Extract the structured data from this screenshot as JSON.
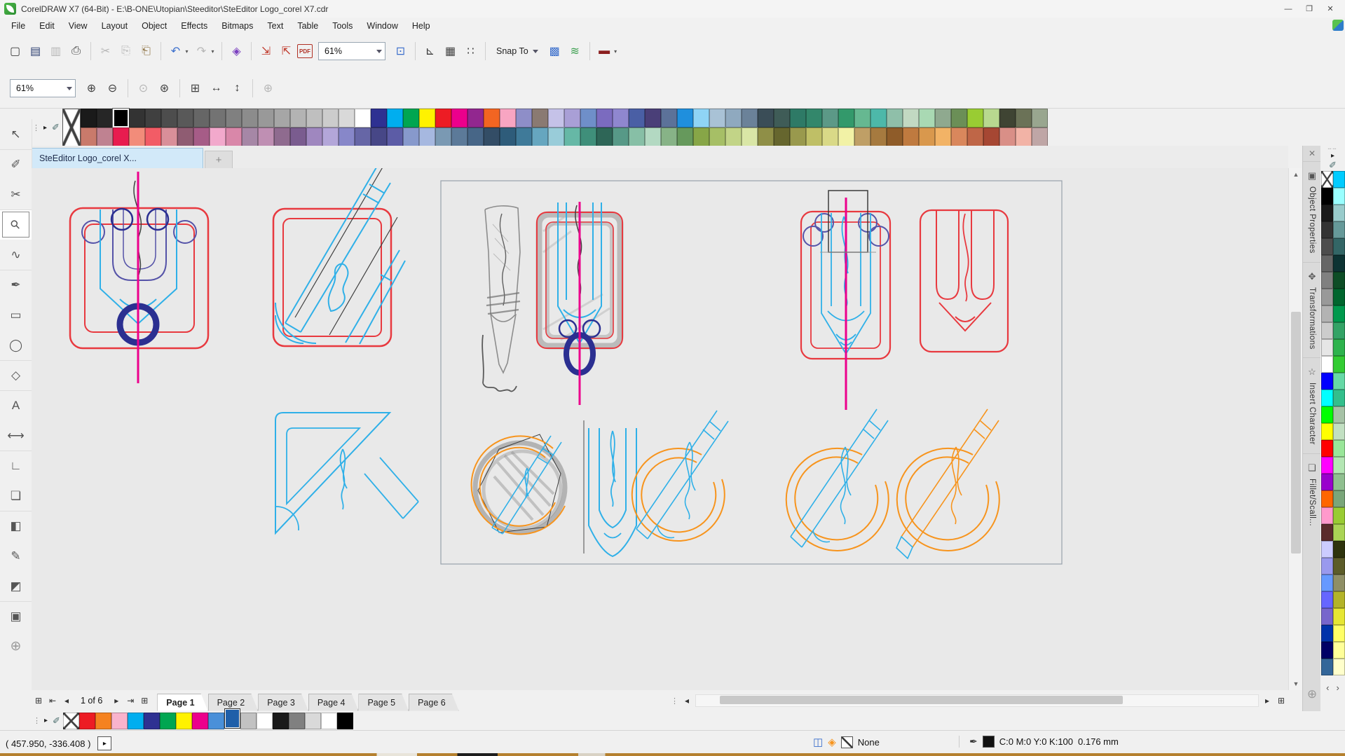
{
  "window": {
    "title": "CorelDRAW X7 (64-Bit) - E:\\B-ONE\\Utopian\\Steeditor\\SteEditor Logo_corel X7.cdr",
    "minimize_icon": "—",
    "restore_icon": "❐",
    "close_icon": "✕"
  },
  "menu": {
    "items": [
      "File",
      "Edit",
      "View",
      "Layout",
      "Object",
      "Effects",
      "Bitmaps",
      "Text",
      "Table",
      "Tools",
      "Window",
      "Help"
    ]
  },
  "toolbar": {
    "zoom_value": "61%",
    "snap_to_label": "Snap To",
    "left_icons": [
      {
        "name": "new-document-icon",
        "glyph": "▢",
        "cls": "ink",
        "ia": "true"
      },
      {
        "name": "open-icon",
        "glyph": "▤",
        "cls": "navy",
        "ia": "true"
      },
      {
        "name": "save-icon",
        "glyph": "▥",
        "cls": "dis",
        "ia": "true"
      },
      {
        "name": "print-icon",
        "glyph": "⎙",
        "cls": "ink",
        "ia": "true"
      },
      {
        "name": "separator",
        "glyph": "",
        "cls": "sep",
        "ia": "false"
      },
      {
        "name": "cut-icon",
        "glyph": "✂",
        "cls": "dis",
        "ia": "true"
      },
      {
        "name": "copy-icon",
        "glyph": "⎘",
        "cls": "dis",
        "ia": "true"
      },
      {
        "name": "paste-icon",
        "glyph": "⎗",
        "cls": "tan",
        "ia": "true"
      },
      {
        "name": "separator",
        "glyph": "",
        "cls": "sep",
        "ia": "false"
      },
      {
        "name": "undo-icon",
        "glyph": "↶",
        "cls": "blue",
        "ia": "true"
      },
      {
        "name": "undo-dropdown-icon",
        "glyph": "▾",
        "cls": "tiny",
        "ia": "true"
      },
      {
        "name": "redo-icon",
        "glyph": "↷",
        "cls": "dis",
        "ia": "true"
      },
      {
        "name": "redo-dropdown-icon",
        "glyph": "▾",
        "cls": "tiny dis",
        "ia": "true"
      },
      {
        "name": "separator",
        "glyph": "",
        "cls": "sep",
        "ia": "false"
      },
      {
        "name": "search-content-icon",
        "glyph": "◈",
        "cls": "purple",
        "ia": "true"
      },
      {
        "name": "separator",
        "glyph": "",
        "cls": "sep",
        "ia": "false"
      },
      {
        "name": "import-icon",
        "glyph": "⇲",
        "cls": "red",
        "ia": "true"
      },
      {
        "name": "export-icon",
        "glyph": "⇱",
        "cls": "red",
        "ia": "true"
      },
      {
        "name": "publish-pdf-icon",
        "glyph": "PDF",
        "cls": "pdf",
        "ia": "true"
      }
    ],
    "mid_icons": [
      {
        "name": "fullscreen-preview-icon",
        "glyph": "⊡",
        "cls": "blue",
        "ia": "true"
      },
      {
        "name": "separator",
        "glyph": "",
        "cls": "sep",
        "ia": "false"
      },
      {
        "name": "show-rulers-icon",
        "glyph": "⊾",
        "cls": "ink",
        "ia": "true"
      },
      {
        "name": "show-grid-icon",
        "glyph": "▦",
        "cls": "ink",
        "ia": "true"
      },
      {
        "name": "show-guidelines-icon",
        "glyph": "∷",
        "cls": "ink",
        "ia": "true"
      },
      {
        "name": "separator",
        "glyph": "",
        "cls": "sep",
        "ia": "false"
      }
    ],
    "right_icons": [
      {
        "name": "options-icon",
        "glyph": "▩",
        "cls": "blue",
        "ia": "true"
      },
      {
        "name": "quick-customize-icon",
        "glyph": "≋",
        "cls": "green",
        "ia": "true"
      },
      {
        "name": "separator",
        "glyph": "",
        "cls": "sep",
        "ia": "false"
      },
      {
        "name": "application-launcher-icon",
        "glyph": "▬",
        "cls": "darkred",
        "ia": "true"
      },
      {
        "name": "launcher-dropdown-icon",
        "glyph": "▾",
        "cls": "tiny",
        "ia": "true"
      }
    ]
  },
  "property_bar": {
    "zoom_value": "61%",
    "icons": [
      {
        "name": "zoom-in-icon",
        "glyph": "⊕",
        "cls": "ink",
        "ia": "true"
      },
      {
        "name": "zoom-out-icon",
        "glyph": "⊖",
        "cls": "ink",
        "ia": "true"
      },
      {
        "name": "separator",
        "glyph": "",
        "cls": "sep",
        "ia": "false"
      },
      {
        "name": "zoom-to-selected-icon",
        "glyph": "⊙",
        "cls": "dis",
        "ia": "true"
      },
      {
        "name": "zoom-to-all-objects-icon",
        "glyph": "⊛",
        "cls": "ink",
        "ia": "true"
      },
      {
        "name": "separator",
        "glyph": "",
        "cls": "sep",
        "ia": "false"
      },
      {
        "name": "zoom-to-page-icon",
        "glyph": "⊞",
        "cls": "ink",
        "ia": "true"
      },
      {
        "name": "zoom-to-page-width-icon",
        "glyph": "↔",
        "cls": "ink",
        "ia": "true"
      },
      {
        "name": "zoom-to-page-height-icon",
        "glyph": "↕",
        "cls": "ink",
        "ia": "true"
      },
      {
        "name": "separator",
        "glyph": "",
        "cls": "sep",
        "ia": "false"
      },
      {
        "name": "zoom-one-shot-icon",
        "glyph": "⊕",
        "cls": "dis",
        "ia": "true"
      }
    ]
  },
  "palette_top": {
    "grip_icon": "⋮",
    "flyout_icon": "▸",
    "eyedropper_icon": "✐",
    "selected_row": 1,
    "selected_index": 2,
    "row1": [
      "#1a1a1a",
      "#262626",
      "#000000",
      "#333333",
      "#404040",
      "#4d4d4d",
      "#595959",
      "#666666",
      "#737373",
      "#808080",
      "#8c8c8c",
      "#999999",
      "#a6a6a6",
      "#b3b3b3",
      "#bfbfbf",
      "#cccccc",
      "#d9d9d9",
      "#ffffff",
      "#2e3192",
      "#00aeef",
      "#00a651",
      "#fff200",
      "#ed1c24",
      "#ec008c",
      "#92278f",
      "#f26522",
      "#f8a5c2",
      "#8e8ec8",
      "#8a7a72",
      "#c5c2e8",
      "#a99fd6",
      "#6f8fc9",
      "#7b6bbf",
      "#8f87cf",
      "#4a5fa5",
      "#4a3f78",
      "#5c7299",
      "#1f8fdd",
      "#8fd4f5",
      "#a9c2d6",
      "#8fa9bf",
      "#6b8299",
      "#3a4d57",
      "#3f5c57",
      "#2e7a66",
      "#33876b",
      "#5c9987",
      "#33996b",
      "#66b891",
      "#4db8a9",
      "#8fbfa9",
      "#c2d9c2",
      "#a9d9b3",
      "#8fa98f",
      "#6b8f57",
      "#99cc33",
      "#b8d98f",
      "#3f4433",
      "#6b7257",
      "#99a68f"
    ],
    "row2": [
      "#c97a6b",
      "#bf8291",
      "#e81c4f",
      "#f28c7a",
      "#f25c66",
      "#d98f99",
      "#8f5c72",
      "#a65c87",
      "#f2a9cc",
      "#d987a9",
      "#a687a6",
      "#bf8fb3",
      "#8f6b8f",
      "#7a5c8f",
      "#9f87bf",
      "#b3a6d9",
      "#8787c9",
      "#6666a6",
      "#474787",
      "#5c5ca6",
      "#8799cc",
      "#a6b8e0",
      "#7a99b3",
      "#5c7a99",
      "#476687",
      "#334d66",
      "#2e5c7a",
      "#3f7a99",
      "#66a6bf",
      "#99ccd9",
      "#66b8a6",
      "#3f8f7a",
      "#2e6657",
      "#579987",
      "#87bfa6",
      "#b3d9c2",
      "#87b387",
      "#66995c",
      "#87a647",
      "#a6bf66",
      "#c2d487",
      "#d9e6a6",
      "#8f8f47",
      "#66662e",
      "#99994d",
      "#bfbf66",
      "#d9d987",
      "#f2f2a6",
      "#bf9f66",
      "#a67a3f",
      "#8f5c29",
      "#bf7a3f",
      "#d9984d",
      "#f2b366",
      "#d9875c",
      "#bf6647",
      "#a64733",
      "#d98f87",
      "#f2b3a6",
      "#bfa6a6"
    ]
  },
  "document_tabs": {
    "active_label": "SteEditor Logo_corel X...",
    "new_tab_icon": "+"
  },
  "toolbox": {
    "tools": [
      {
        "name": "pick-tool",
        "glyph": "↖",
        "active": "false",
        "ia": "true"
      },
      {
        "name": "shape-tool",
        "glyph": "✐",
        "active": "false",
        "ia": "true"
      },
      {
        "name": "crop-tool",
        "glyph": "✂",
        "active": "false",
        "ia": "true"
      },
      {
        "name": "zoom-tool",
        "glyph": "⚲",
        "active": "true",
        "ia": "true"
      },
      {
        "name": "freehand-tool",
        "glyph": "∿",
        "active": "false",
        "ia": "true"
      },
      {
        "name": "artistic-media-tool",
        "glyph": "✒",
        "active": "false",
        "ia": "true"
      },
      {
        "name": "rectangle-tool",
        "glyph": "▭",
        "active": "false",
        "ia": "true"
      },
      {
        "name": "ellipse-tool",
        "glyph": "◯",
        "active": "false",
        "ia": "true"
      },
      {
        "name": "polygon-tool",
        "glyph": "◇",
        "active": "false",
        "ia": "true"
      },
      {
        "name": "text-tool",
        "glyph": "A",
        "active": "false",
        "ia": "true"
      },
      {
        "name": "dimension-tool",
        "glyph": "⟷",
        "active": "false",
        "ia": "true"
      },
      {
        "name": "connector-tool",
        "glyph": "∟",
        "active": "false",
        "ia": "true"
      },
      {
        "name": "drop-shadow-tool",
        "glyph": "❏",
        "active": "false",
        "ia": "true"
      },
      {
        "name": "transparency-tool",
        "glyph": "◧",
        "active": "false",
        "ia": "true"
      },
      {
        "name": "color-eyedropper-tool",
        "glyph": "✎",
        "active": "false",
        "ia": "true"
      },
      {
        "name": "interactive-fill-tool",
        "glyph": "◩",
        "active": "false",
        "ia": "true"
      },
      {
        "name": "smart-fill-tool",
        "glyph": "▣",
        "active": "false",
        "ia": "true"
      },
      {
        "name": "add-tools-button",
        "glyph": "⊕",
        "active": "false",
        "ia": "true"
      }
    ]
  },
  "canvas": {
    "colors": {
      "outline_red": "#e8393f",
      "outline_cyan": "#2fb0e8",
      "outline_navy": "#2b2f91",
      "outline_purple": "#5553a8",
      "guide_magenta": "#ec008c",
      "outline_orange": "#f7941d",
      "sketch_gray": "#8d8d8d",
      "page_fill": "#ffffff",
      "desktop_fill": "#e9e9e9"
    }
  },
  "v_scrollbar": {
    "up_icon": "▲",
    "down_icon": "▼"
  },
  "h_scrollbar": {
    "grip_icon": "⋮",
    "left_icon": "◂",
    "right_icon": "▸",
    "page_zoom_icon": "⊞"
  },
  "dockers": {
    "close_icon": "✕",
    "add_icon": "⊕",
    "tabs": [
      {
        "name": "docker-tab-object-properties",
        "label": "Object Properties",
        "icon": "▣",
        "ia": "true"
      },
      {
        "name": "docker-tab-transformations",
        "label": "Transformations",
        "icon": "✥",
        "ia": "true"
      },
      {
        "name": "docker-tab-insert-character",
        "label": "Insert Character",
        "icon": "☆",
        "ia": "true"
      },
      {
        "name": "docker-tab-fillet-scallop",
        "label": "Fillet/Scall...",
        "icon": "❏",
        "ia": "true"
      }
    ]
  },
  "palette_right": {
    "grip_icon": "┄┄",
    "flyout_icon": "▸",
    "eyedropper_icon": "✐",
    "scroll_left_icon": "‹",
    "scroll_right_icon": "›",
    "col1": [
      "none",
      "#000000",
      "#1a1a1a",
      "#333333",
      "#4d4d4d",
      "#666666",
      "#808080",
      "#999999",
      "#b3b3b3",
      "#cccccc",
      "#e6e6e6",
      "#ffffff",
      "#0000ff",
      "#00ffff",
      "#00ff00",
      "#ffff00",
      "#ff0000",
      "#ff00ff",
      "#9900cc",
      "#ff6600",
      "#ff99cc",
      "#5b2b2b",
      "#ccccff",
      "#9999ee",
      "#6699ff",
      "#6666ff",
      "#7766cc",
      "#0033aa",
      "#000066",
      "#336699"
    ],
    "col2": [
      "#00ccff",
      "#99ffff",
      "#99cccc",
      "#669999",
      "#336666",
      "#0d3333",
      "#0d4d26",
      "#00662e",
      "#00994d",
      "#33a366",
      "#2eb34d",
      "#33cc33",
      "#66d9a6",
      "#33bf8c",
      "#a6c2a6",
      "#c2e0c2",
      "#99e699",
      "#b3e6b3",
      "#8fbf8f",
      "#7aa67a",
      "#99cc33",
      "#aad455",
      "#2e330d",
      "#5c5c29",
      "#8f8f66",
      "#b3b329",
      "#e6e633",
      "#ffff66",
      "#ffff99",
      "#ffffcc"
    ]
  },
  "page_nav": {
    "add_page_left_icon": "⊞",
    "first_icon": "⇤",
    "prev_icon": "◂",
    "position_label": "1 of 6",
    "next_icon": "▸",
    "last_icon": "⇥",
    "add_page_right_icon": "⊞",
    "active_tab": "Page 1",
    "tabs": [
      "Page 1",
      "Page 2",
      "Page 3",
      "Page 4",
      "Page 5",
      "Page 6"
    ]
  },
  "palette_bottom": {
    "grip_icon": "⋮",
    "flyout_icon": "▸",
    "eyedropper_icon": "✐",
    "selected_index": 10,
    "colors": [
      "none",
      "#ed1c24",
      "#f58220",
      "#f9b3cc",
      "#00aeef",
      "#2e3192",
      "#00a651",
      "#fff200",
      "#ec008c",
      "#4a90d9",
      "#1f5fa9",
      "#c2c2c2",
      "#ffffff",
      "#1a1a1a",
      "#808080",
      "#d9d9d9",
      "#ffffff",
      "#000000"
    ]
  },
  "status_bar": {
    "cursor_coords": "( 457.950, -336.408 )",
    "expand_icon": "▸",
    "proof_icon": "◫",
    "fill_icon": "◈",
    "fill_value": "None",
    "outline_icon": "✒",
    "outline_color": "C:0 M:0 Y:0 K:100",
    "outline_width": "0.176 mm"
  }
}
